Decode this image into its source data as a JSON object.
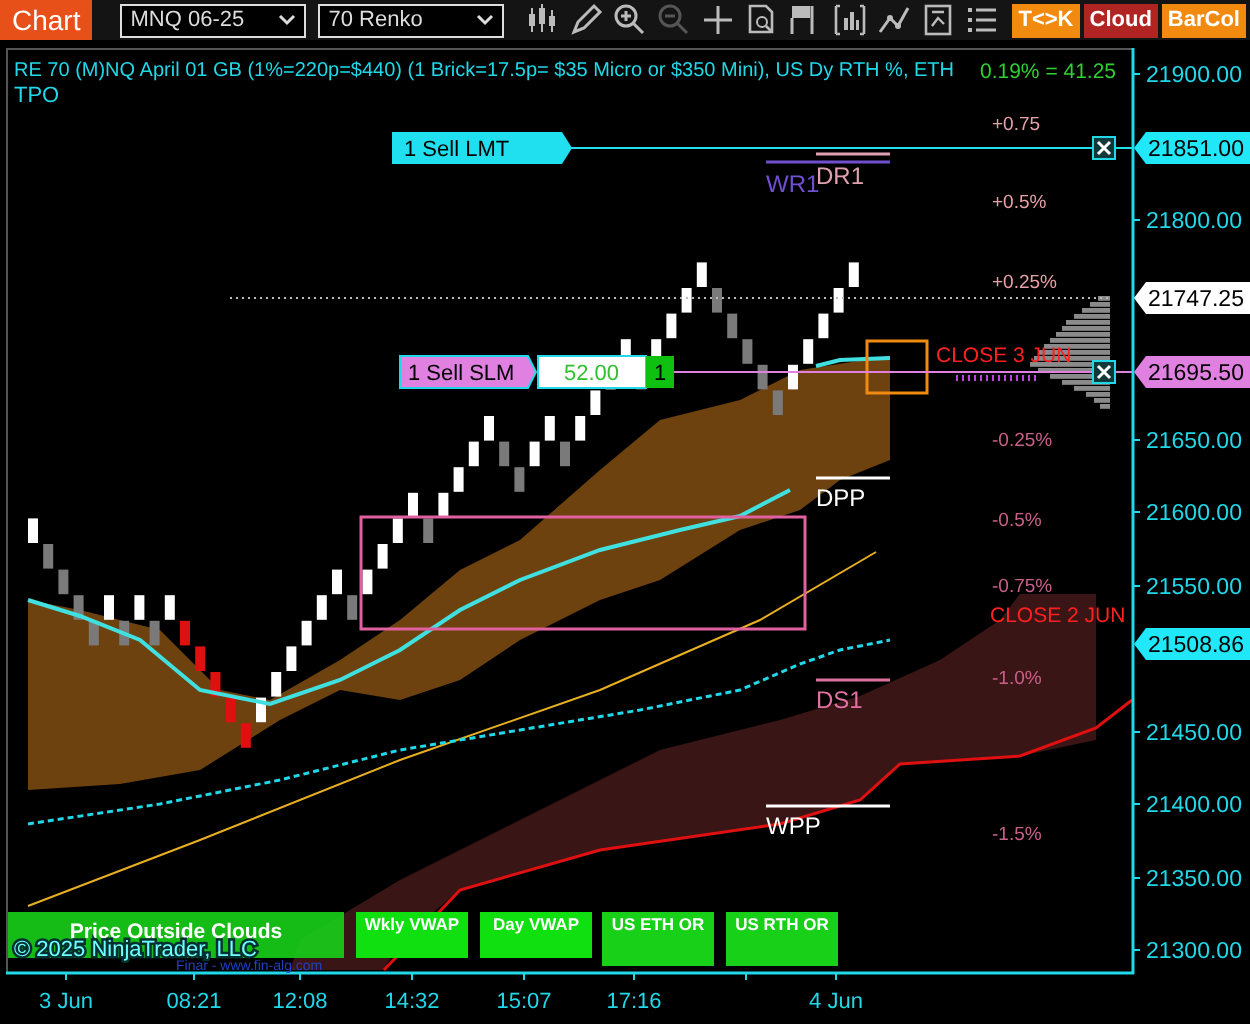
{
  "toolbar": {
    "tab": "Chart",
    "instrument": "MNQ 06-25",
    "interval": "70 Renko",
    "tools": [
      {
        "kind": "bars",
        "disabled": false
      },
      {
        "kind": "pencil",
        "disabled": false
      },
      {
        "kind": "zoom-in",
        "disabled": false
      },
      {
        "kind": "zoom-out",
        "disabled": true
      },
      {
        "kind": "crosshair",
        "disabled": false
      },
      {
        "kind": "properties",
        "disabled": false
      },
      {
        "kind": "template",
        "disabled": false
      },
      {
        "kind": "indicators",
        "disabled": false
      },
      {
        "kind": "strategy",
        "disabled": false
      },
      {
        "kind": "calculator",
        "disabled": false
      },
      {
        "kind": "list",
        "disabled": false
      }
    ],
    "toggles": [
      {
        "label": "T<>K",
        "color": "#f28a10"
      },
      {
        "label": "Cloud",
        "color": "#b02424"
      },
      {
        "label": "BarCol",
        "color": "#f28a10"
      }
    ]
  },
  "chart": {
    "title": "RE 70 (M)NQ April 01 GB (1%=220p=$440) (1 Brick=17.5p= $35 Micro or $350 Mini), US Dy RTH %, ETH",
    "subtitle": "TPO",
    "change": "0.19% = 41.25",
    "percent_levels": [
      "+0.75",
      "+0.5%",
      "+0.25%",
      "-0.25%",
      "-0.5%",
      "-0.75%",
      "-1.0%",
      "-1.5%"
    ],
    "pivots": [
      {
        "label": "DR1",
        "color": "#e0a0b0"
      },
      {
        "label": "WR1",
        "color": "#7050d0"
      },
      {
        "label": "DPP",
        "color": "#ffffff"
      },
      {
        "label": "DS1",
        "color": "#e070a0"
      },
      {
        "label": "WPP",
        "color": "#ffffff"
      }
    ],
    "closes": [
      "CLOSE 3 JUN",
      "CLOSE 2 JUN"
    ],
    "orders": [
      {
        "label": "1 Sell LMT",
        "color": "#20e0f0"
      },
      {
        "label": "1 Sell SLM",
        "color": "#e080e0",
        "price": "52.00",
        "quantity": "1"
      }
    ],
    "price_axis": [
      "21900.00",
      "21800.00",
      "21650.00",
      "21600.00",
      "21550.00",
      "21450.00",
      "21400.00",
      "21350.00",
      "21300.00"
    ],
    "markers": [
      {
        "price": "21851.00",
        "color": "#20e8f8"
      },
      {
        "price": "21747.25",
        "color": "#ffffff"
      },
      {
        "price": "21695.50",
        "color": "#e080e0"
      },
      {
        "price": "21508.86",
        "color": "#20e8f8"
      }
    ],
    "time_axis": [
      "3 Jun",
      "08:21",
      "12:08",
      "14:32",
      "15:07",
      "17:16",
      "4 Jun"
    ],
    "indicators": [
      "Price Outside Clouds",
      "Wkly VWAP",
      "Day VWAP",
      "US ETH OR",
      "US RTH OR"
    ],
    "copyright": "© 2025 NinjaTrader, LLC",
    "vendor": "Finar - www.fin-alg.com"
  }
}
